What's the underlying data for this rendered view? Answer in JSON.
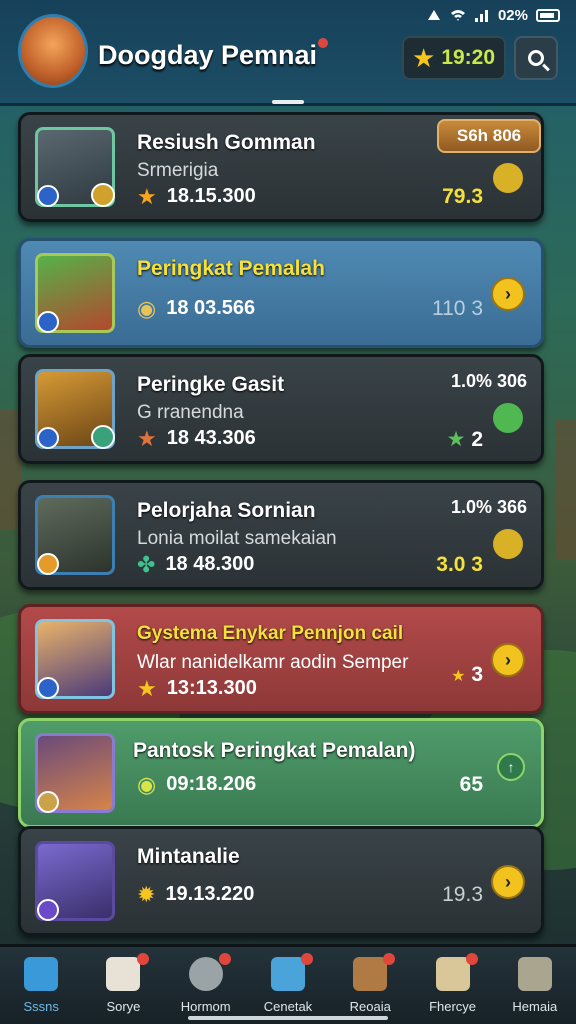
{
  "status_bar": {
    "battery": "02%"
  },
  "header": {
    "title": "Doogday Pemnai",
    "coins": "19:20"
  },
  "cards": [
    {
      "title": "Resiush Gomman",
      "subtitle": "Srmerigia",
      "score": "18.15.300",
      "pill": "S6h 806",
      "right_value": "79.3"
    },
    {
      "title": "Peringkat Pemalah",
      "subtitle": "",
      "score": "18 03.566",
      "right_value": "110 3"
    },
    {
      "title": "Peringke Gasit",
      "subtitle": "G rranendna",
      "score": "18 43.306",
      "right_top": "1.0% 306",
      "right_value": "2"
    },
    {
      "title": "Pelorjaha Sornian",
      "subtitle": "Lonia moilat samekaian",
      "score": "18 48.300",
      "right_top": "1.0% 366",
      "right_value": "3.0 3"
    },
    {
      "title": "Gystema Enykar Pennjon cail",
      "subtitle": "Wlar nanidelkamr aodin Semper",
      "score": "13:13.300",
      "right_value": "3"
    },
    {
      "title": "Pantosk Peringkat Pemalan)",
      "subtitle": "",
      "score": "09:18.206",
      "right_value": "65"
    },
    {
      "title": "Mintanalie",
      "subtitle": "",
      "score": "19.13.220",
      "right_value": "19.3"
    }
  ],
  "nav": [
    {
      "label": "Sssns"
    },
    {
      "label": "Sorye"
    },
    {
      "label": "Hormom"
    },
    {
      "label": "Cenetak"
    },
    {
      "label": "Reoaia"
    },
    {
      "label": "Fhercye"
    },
    {
      "label": "Hemaia"
    }
  ],
  "colors": {
    "accent": "#f2c21f",
    "header": "#17415a",
    "card_dark": "#2a3236",
    "card_blue": "#3a6c94",
    "card_red": "#8d3838",
    "card_green": "#3a7a52"
  },
  "icons": [
    "signal-icon",
    "wifi-icon",
    "battery-icon",
    "star-icon",
    "search-icon",
    "chevron-right-icon",
    "home-icon"
  ]
}
